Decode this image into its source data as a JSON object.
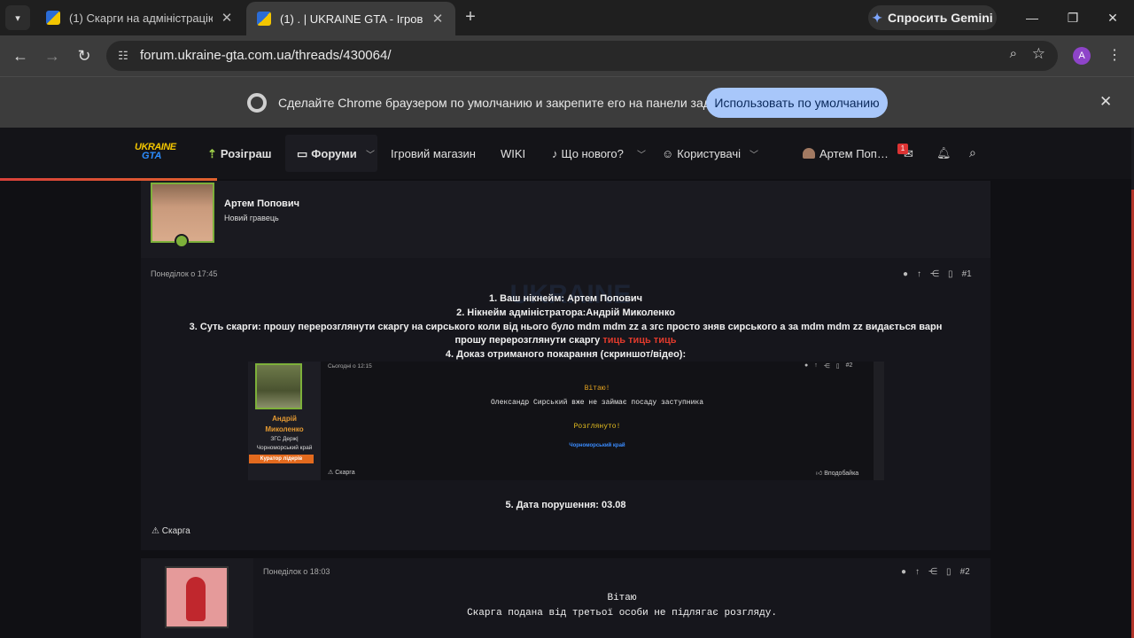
{
  "browser": {
    "tabs": [
      {
        "title": "(1) Скарги на адміністрацію | U"
      },
      {
        "title": "(1) . | UKRAINE GTA - Ігровий ф"
      }
    ],
    "gemini_label": "Спросить Gemini",
    "url": "forum.ukraine-gta.com.ua/threads/430064/",
    "profile_initial": "A",
    "infobar_message": "Сделайте Chrome браузером по умолчанию и закрепите его на панели задач.",
    "infobar_button": "Использовать по умолчанию"
  },
  "site_nav": {
    "logo_top": "UKRAINE",
    "logo_bottom": "GTA",
    "items": [
      "Розіграш",
      "Форуми",
      "Ігровий магазин",
      "WIKI",
      "Що нового?",
      "Користувачі"
    ],
    "user": "Артем Поп…",
    "mail_badge": "1"
  },
  "post1": {
    "author": "Артем Попович",
    "role": "Новий гравець",
    "date": "Понеділок о 17:45",
    "number": "#1",
    "lines": {
      "l1": "1. Ваш нікнейм: Артем Попович",
      "l2": "2. Нікнейм адміністратора:Андрій Миколенко",
      "l3": "3. Суть скарги: прошу перерозглянути скаргу на сирського коли від нього було mdm mdm zz а згс просто зняв сирського а за mdm mdm zz видається варн",
      "l4": "прошу перерозглянути скаргу ",
      "l4_red": "тиць тиць тиць",
      "l5": "4. Доказ отриманого покарання (скриншот/відео):",
      "l6": "5. Дата порушення: 03.08"
    },
    "report": "Скарга",
    "watermark": "UKRAINE"
  },
  "embed": {
    "name1": "Андрій",
    "name2": "Миколенко",
    "sub1": "ЗГС Держ|",
    "sub2": "Чорноморський край",
    "curator": "Куратор лідерів",
    "date": "Сьогодні о 12:15",
    "number": "#2",
    "greeting": "Вітаю!",
    "text": "Олександр Сирський вже не займає посаду заступника",
    "reviewed": "Розглянуто!",
    "region": "Чорноморський край",
    "report": "Скарга",
    "like": "Вподобайка",
    "colors": {
      "greeting": "#e0a020",
      "reviewed": "#e8c020",
      "region": "#3a8cff"
    }
  },
  "post2": {
    "date": "Понеділок о 18:03",
    "number": "#2",
    "greeting": "Вітаю",
    "text": "Скарга подана від третьої особи не підлягає розгляду."
  }
}
